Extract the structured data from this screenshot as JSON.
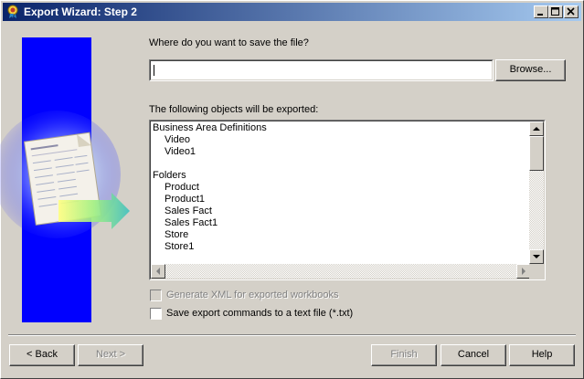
{
  "window": {
    "title": "Export Wizard: Step 2",
    "controls": [
      "minimize-icon",
      "maximize-icon",
      "close-icon"
    ]
  },
  "file_section": {
    "prompt": "Where do you want to save the file?",
    "path_value": "",
    "browse_label": "Browse..."
  },
  "objects_section": {
    "label": "The following objects will be exported:",
    "items": [
      "Business Area Definitions",
      "Video",
      "Video1",
      "",
      "Folders",
      "Product",
      "Product1",
      "Sales Fact",
      "Sales Fact1",
      "Store",
      "Store1"
    ]
  },
  "options": {
    "generate_xml_label": "Generate XML for exported workbooks",
    "generate_xml_enabled": false,
    "save_commands_label": "Save export commands to a text file (*.txt)",
    "save_commands_checked": false
  },
  "buttons": {
    "back": "< Back",
    "next": "Next >",
    "finish": "Finish",
    "cancel": "Cancel",
    "help": "Help"
  },
  "colors": {
    "title_start": "#0a246a",
    "title_end": "#a6caf0",
    "side_panel": "#0000ff",
    "face": "#d4d0c8"
  }
}
